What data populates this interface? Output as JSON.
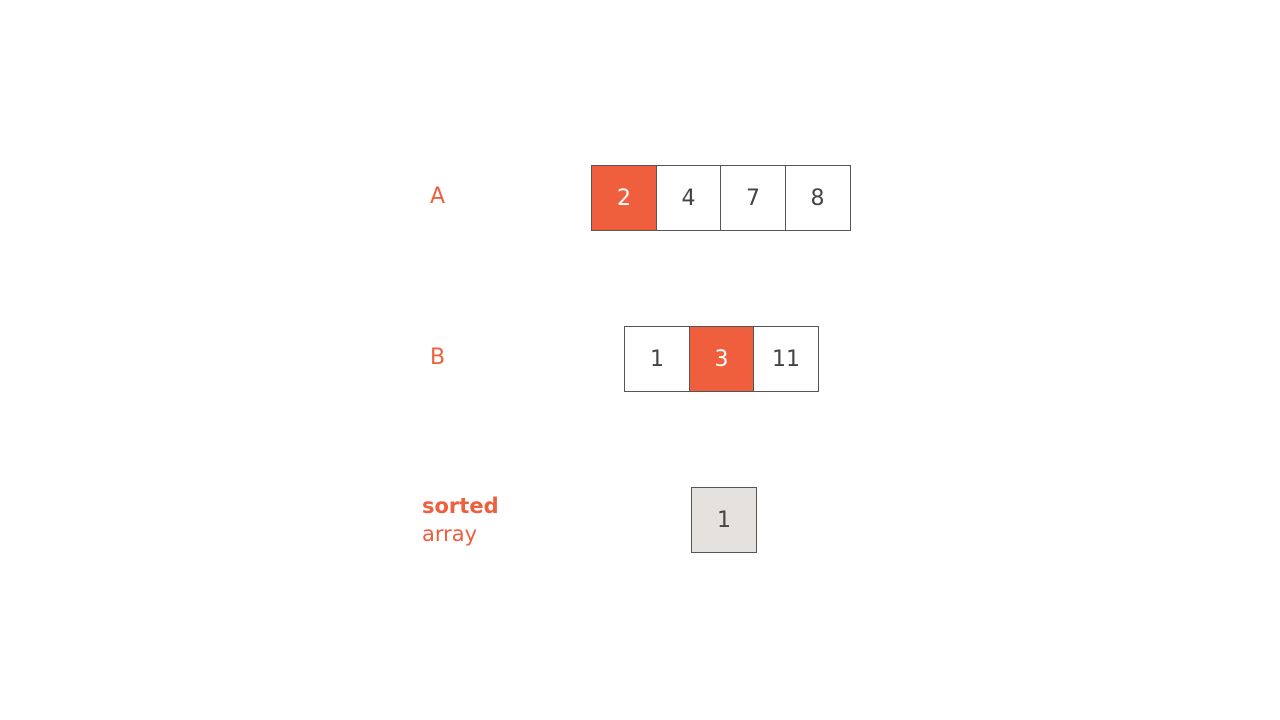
{
  "arrays": {
    "A": {
      "label": "A",
      "values": [
        "2",
        "4",
        "7",
        "8"
      ],
      "highlight_index": 0
    },
    "B": {
      "label": "B",
      "values": [
        "1",
        "3",
        "11"
      ],
      "highlight_index": 1
    }
  },
  "sorted": {
    "label_bold": "sorted",
    "label_rest": "array",
    "values": [
      "1"
    ]
  },
  "colors": {
    "highlight": "#ef5f3e",
    "label": "#ec5f3f",
    "sorted_fill": "#e4e1de"
  }
}
